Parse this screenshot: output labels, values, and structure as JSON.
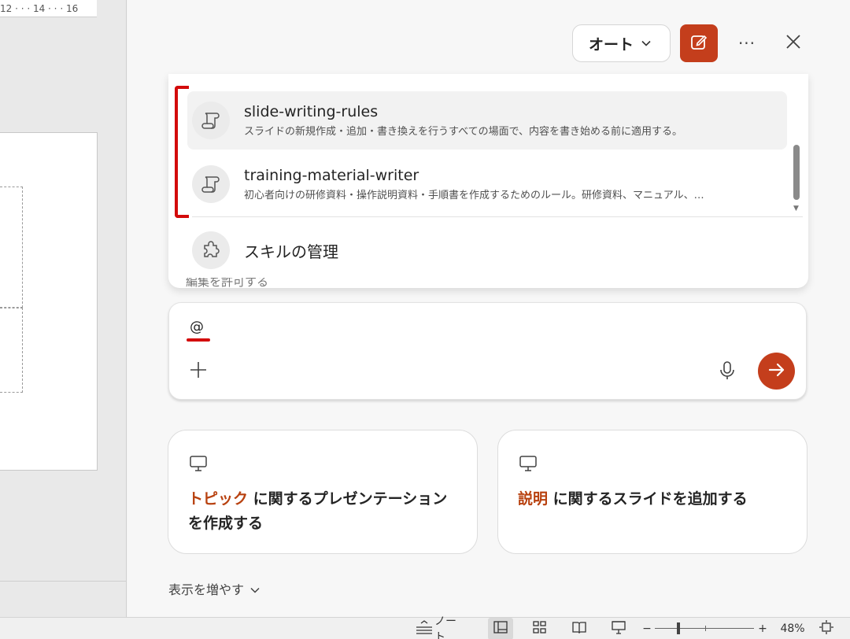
{
  "ruler": {
    "text": "12 · · · 14 · · · 16"
  },
  "header": {
    "mode_label": "オート",
    "new_chat_icon": "compose-icon",
    "more_label": "···",
    "close_icon": "close-icon"
  },
  "skills_popup": {
    "items": [
      {
        "name": "slide-writing-rules",
        "description": "スライドの新規作成・追加・書き換えを行うすべての場面で、内容を書き始める前に適用する。",
        "icon": "scroll-icon",
        "selected": true
      },
      {
        "name": "training-material-writer",
        "description": "初心者向けの研修資料・操作説明資料・手順書を作成するためのルール。研修資料、マニュアル、…",
        "icon": "scroll-icon",
        "selected": false
      }
    ],
    "manage_label": "スキルの管理",
    "manage_icon": "puzzle-icon"
  },
  "peek_text": "編集を許可する",
  "composer": {
    "value": "@",
    "add_icon": "plus-icon",
    "mic_icon": "microphone-icon",
    "send_icon": "arrow-right-icon"
  },
  "suggestions": [
    {
      "keyword": "トピック",
      "text": " に関するプレゼンテーションを作成する",
      "icon": "presentation-icon"
    },
    {
      "keyword": "説明",
      "text": " に関するスライドを追加する",
      "icon": "presentation-icon"
    }
  ],
  "show_more_label": "表示を増やす",
  "status_bar": {
    "notes_label": "ノート",
    "zoom_minus": "−",
    "zoom_plus": "+",
    "zoom_level": "48%"
  },
  "colors": {
    "accent": "#c43e1c",
    "highlight_red": "#d30b0b",
    "keyword": "#b8410f"
  }
}
